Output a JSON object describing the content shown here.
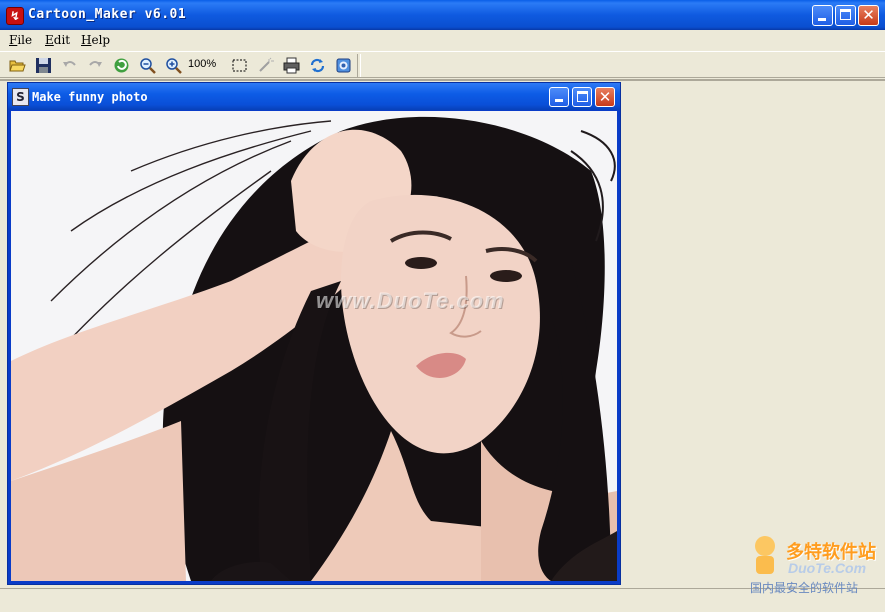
{
  "app": {
    "title": "Cartoon_Maker v6.01"
  },
  "menu": [
    {
      "label": "File"
    },
    {
      "label": "Edit"
    },
    {
      "label": "Help"
    }
  ],
  "toolbar": {
    "zoom": "100%",
    "buttons": [
      {
        "icon": "open-folder-icon"
      },
      {
        "icon": "save-disk-icon"
      },
      {
        "icon": "undo-icon"
      },
      {
        "icon": "redo-icon"
      },
      {
        "icon": "refresh-icon"
      },
      {
        "icon": "zoom-out-icon"
      },
      {
        "icon": "zoom-in-icon"
      },
      {
        "icon": "select-rect-icon"
      },
      {
        "icon": "magic-wand-icon"
      },
      {
        "icon": "print-icon"
      },
      {
        "icon": "rotate-icon"
      },
      {
        "icon": "about-icon"
      }
    ]
  },
  "child_window": {
    "title": "Make funny photo",
    "photo_watermark": "www.DuoTe.com"
  },
  "corner_watermark": {
    "cn": "多特软件站",
    "en": "DuoTe.Com",
    "sub": "国内最安全的软件站"
  },
  "colors": {
    "titlebar": "#0a5ee8",
    "face": "#ece9d8",
    "accent_orange": "#ff9d1f"
  }
}
